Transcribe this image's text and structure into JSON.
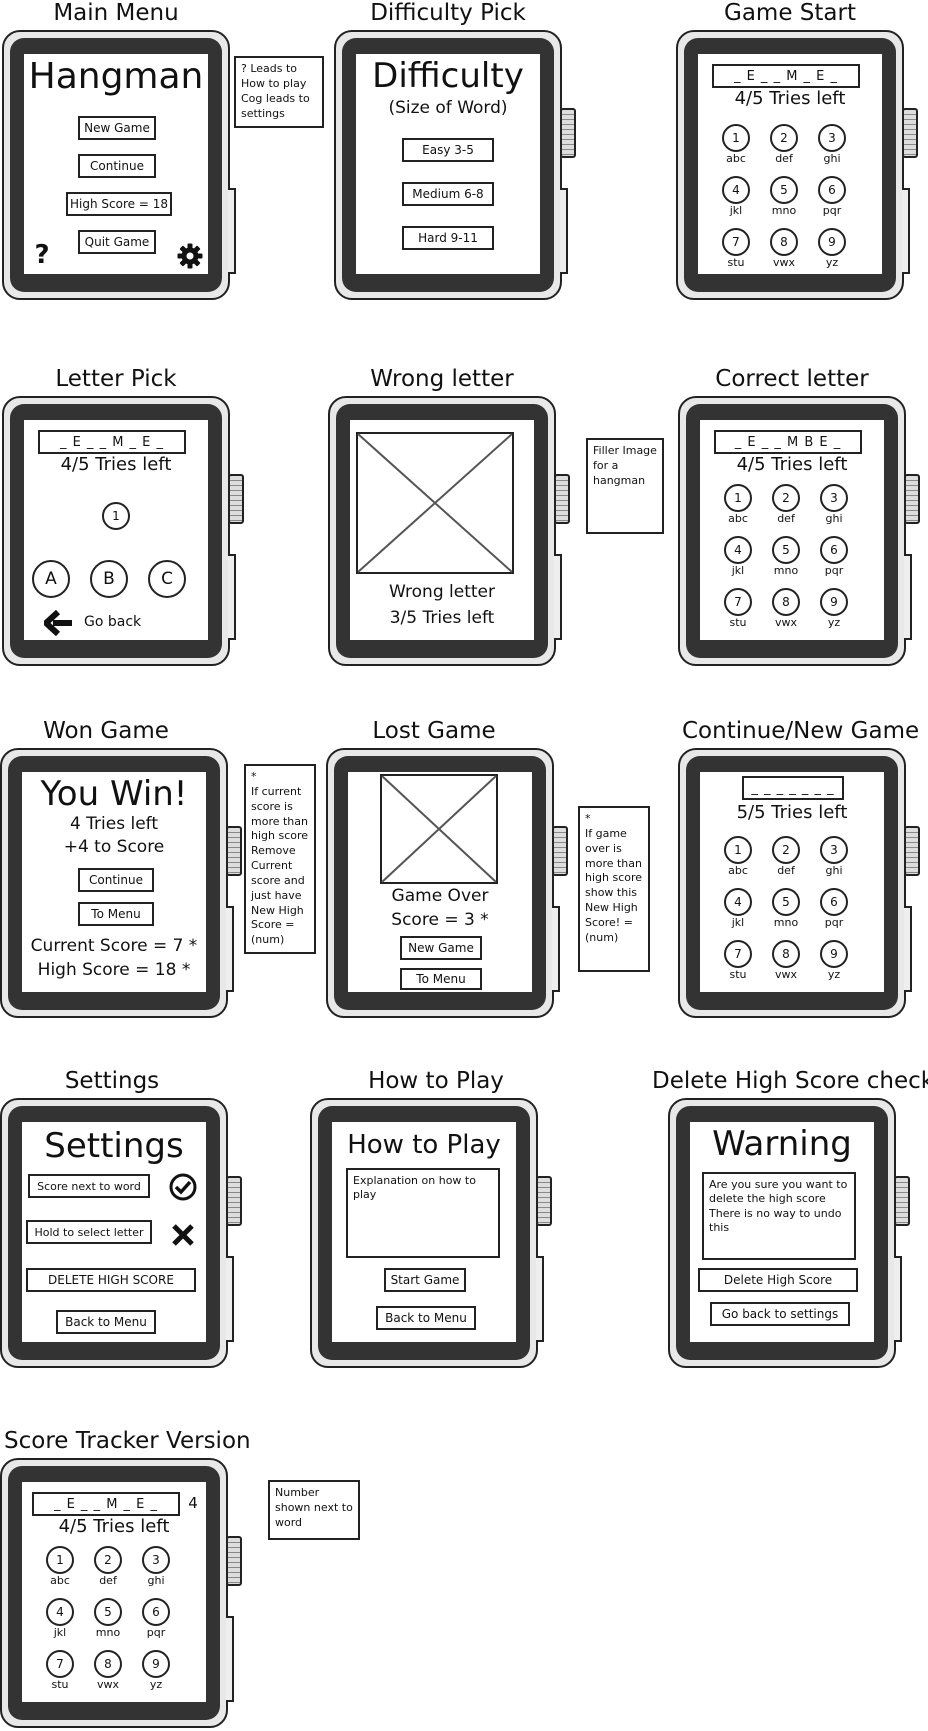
{
  "frames": [
    "Main Menu",
    "Difficulty Pick",
    "Game Start",
    "Letter Pick",
    "Wrong letter",
    "Correct letter",
    "Won Game",
    "Lost Game",
    "Continue/New Game",
    "Settings",
    "How to Play",
    "Delete High Score check",
    "Score Tracker Version"
  ],
  "main_menu": {
    "heading": "Hangman",
    "new_game": "New Game",
    "continue": "Continue",
    "high_score": "High Score = 18",
    "quit": "Quit Game",
    "help": "?",
    "note": "? Leads to How to play\nCog leads to settings"
  },
  "difficulty": {
    "heading": "Difficulty",
    "subheading": "(Size of Word)",
    "easy": "Easy 3-5",
    "medium": "Medium 6-8",
    "hard": "Hard 9-11"
  },
  "keypad": {
    "keys": [
      {
        "num": "1",
        "letters": "abc"
      },
      {
        "num": "2",
        "letters": "def"
      },
      {
        "num": "3",
        "letters": "ghi"
      },
      {
        "num": "4",
        "letters": "jkl"
      },
      {
        "num": "5",
        "letters": "mno"
      },
      {
        "num": "6",
        "letters": "pqr"
      },
      {
        "num": "7",
        "letters": "stu"
      },
      {
        "num": "8",
        "letters": "vwx"
      },
      {
        "num": "9",
        "letters": "yz"
      }
    ]
  },
  "game_start": {
    "word": "_ E _ _ M _ E _",
    "tries": "4/5 Tries left"
  },
  "letter_pick": {
    "word": "_ E _ _ M _ E _",
    "tries": "4/5 Tries left",
    "key": "1",
    "letters": [
      "A",
      "B",
      "C"
    ],
    "go_back": "Go back"
  },
  "wrong_letter": {
    "line1": "Wrong letter",
    "line2": "3/5 Tries left",
    "note": "Filler Image for a hangman"
  },
  "correct_letter": {
    "word": "_ E _ _ M B E _",
    "tries": "4/5 Tries left"
  },
  "won": {
    "heading": "You Win!",
    "tries": "4 Tries left",
    "score_add": "+4 to Score",
    "continue": "Continue",
    "to_menu": "To Menu",
    "current": "Current Score = 7 *",
    "high": "High Score = 18 *",
    "note": "*\nIf current score is more than high score Remove Current score and just have New High Score = (num)"
  },
  "lost": {
    "line1": "Game Over",
    "line2": "Score = 3 *",
    "new_game": "New Game",
    "to_menu": "To Menu",
    "note": "*\nIf game over is more than high score show this New High Score! = (num)"
  },
  "continue_new": {
    "word": "_ _ _ _ _ _ _",
    "tries": "5/5 Tries left"
  },
  "settings": {
    "heading": "Settings",
    "opt1": "Score next to word",
    "opt2": "Hold to select letter",
    "delete": "DELETE HIGH SCORE",
    "back": "Back to Menu"
  },
  "how_to": {
    "heading": "How to Play",
    "explanation": "Explanation on how to play",
    "start": "Start Game",
    "back": "Back to Menu"
  },
  "warning": {
    "heading": "Warning",
    "message": "Are you sure you want to delete the high score There is no way to undo this",
    "delete": "Delete High Score",
    "back": "Go back to settings"
  },
  "score_tracker": {
    "word": "_ E _ _ M _ E _",
    "score": "4",
    "tries": "4/5 Tries left",
    "note": "Number shown next to word"
  }
}
